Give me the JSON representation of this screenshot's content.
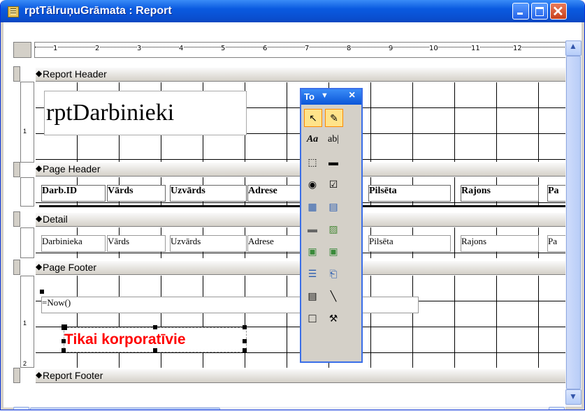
{
  "window": {
    "title": "rptTālruņuGrāmata : Report"
  },
  "ruler": {
    "marks": [
      "1",
      "2",
      "3",
      "4",
      "5",
      "6",
      "7",
      "8",
      "9",
      "10",
      "11",
      "12"
    ]
  },
  "sections": {
    "report_header": "Report Header",
    "page_header": "Page Header",
    "detail": "Detail",
    "page_footer": "Page Footer",
    "report_footer": "Report Footer"
  },
  "report_header": {
    "title": "rptDarbinieki"
  },
  "page_header": {
    "labels": [
      "Darb.ID",
      "Vārds",
      "Uzvārds",
      "Adrese",
      "Pilsēta",
      "Rajons",
      "Pa"
    ]
  },
  "detail": {
    "fields": [
      "Darbinieka",
      "Vārds",
      "Uzvārds",
      "Adrese",
      "Pilsēta",
      "Rajons",
      "Pa"
    ]
  },
  "page_footer": {
    "now": "=Now()",
    "notice": "Tikai korporatīvie"
  },
  "toolbox": {
    "title": "To",
    "dropdown": "▼",
    "close": "×"
  },
  "vruler": {
    "rh": "1",
    "pf1": "1",
    "pf2": "2"
  },
  "colors": {
    "titlebar": "#0a55d8",
    "notice": "#ff0000"
  }
}
